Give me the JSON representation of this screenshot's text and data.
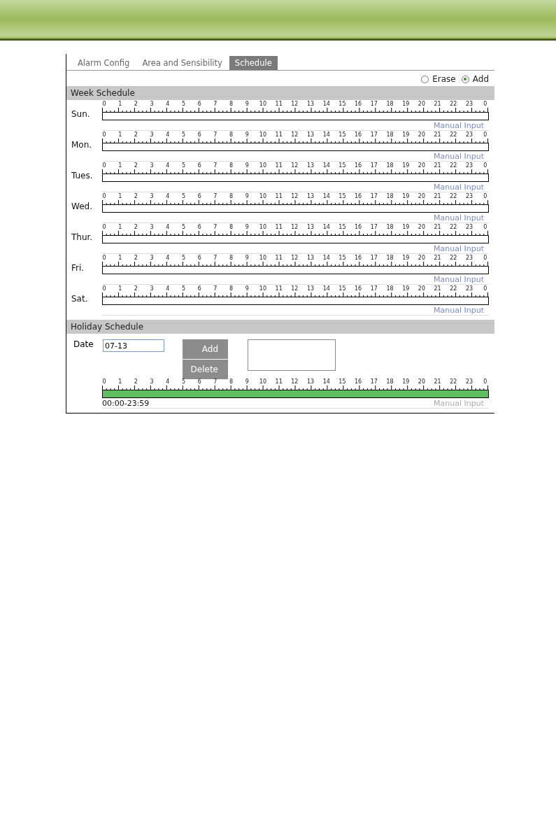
{
  "tabs": [
    {
      "label": "Alarm Config",
      "selected": false
    },
    {
      "label": "Area and Sensibility",
      "selected": false
    },
    {
      "label": "Schedule",
      "selected": true
    }
  ],
  "mode_options": [
    {
      "label": "Erase",
      "selected": false
    },
    {
      "label": "Add",
      "selected": true
    }
  ],
  "week_schedule": {
    "title": "Week Schedule",
    "days": [
      {
        "label": "Sun.",
        "hours": [
          "0",
          "1",
          "2",
          "3",
          "4",
          "5",
          "6",
          "7",
          "8",
          "9",
          "10",
          "11",
          "12",
          "13",
          "14",
          "15",
          "16",
          "17",
          "18",
          "19",
          "20",
          "21",
          "22",
          "23",
          "0"
        ],
        "manual_input": "Manual Input"
      },
      {
        "label": "Mon.",
        "hours": [
          "0",
          "1",
          "2",
          "3",
          "4",
          "5",
          "6",
          "7",
          "8",
          "9",
          "10",
          "11",
          "12",
          "13",
          "14",
          "15",
          "16",
          "17",
          "18",
          "19",
          "20",
          "21",
          "22",
          "23",
          "0"
        ],
        "manual_input": "Manual Input"
      },
      {
        "label": "Tues.",
        "hours": [
          "0",
          "1",
          "2",
          "3",
          "4",
          "5",
          "6",
          "7",
          "8",
          "9",
          "10",
          "11",
          "12",
          "13",
          "14",
          "15",
          "16",
          "17",
          "18",
          "19",
          "20",
          "21",
          "22",
          "23",
          "0"
        ],
        "manual_input": "Manual Input"
      },
      {
        "label": "Wed.",
        "hours": [
          "0",
          "1",
          "2",
          "3",
          "4",
          "5",
          "6",
          "7",
          "8",
          "9",
          "10",
          "11",
          "12",
          "13",
          "14",
          "15",
          "16",
          "17",
          "18",
          "19",
          "20",
          "21",
          "22",
          "23",
          "0"
        ],
        "manual_input": "Manual Input"
      },
      {
        "label": "Thur.",
        "hours": [
          "0",
          "1",
          "2",
          "3",
          "4",
          "5",
          "6",
          "7",
          "8",
          "9",
          "10",
          "11",
          "12",
          "13",
          "14",
          "15",
          "16",
          "17",
          "18",
          "19",
          "20",
          "21",
          "22",
          "23",
          "0"
        ],
        "manual_input": "Manual Input"
      },
      {
        "label": "Fri.",
        "hours": [
          "0",
          "1",
          "2",
          "3",
          "4",
          "5",
          "6",
          "7",
          "8",
          "9",
          "10",
          "11",
          "12",
          "13",
          "14",
          "15",
          "16",
          "17",
          "18",
          "19",
          "20",
          "21",
          "22",
          "23",
          "0"
        ],
        "manual_input": "Manual Input"
      },
      {
        "label": "Sat.",
        "hours": [
          "0",
          "1",
          "2",
          "3",
          "4",
          "5",
          "6",
          "7",
          "8",
          "9",
          "10",
          "11",
          "12",
          "13",
          "14",
          "15",
          "16",
          "17",
          "18",
          "19",
          "20",
          "21",
          "22",
          "23",
          "0"
        ],
        "manual_input": "Manual Input"
      }
    ]
  },
  "holiday_schedule": {
    "title": "Holiday Schedule",
    "date_label": "Date",
    "date_value": "07-13",
    "buttons": [
      "Add",
      "Delete"
    ],
    "hours": [
      "0",
      "1",
      "2",
      "3",
      "4",
      "5",
      "6",
      "7",
      "8",
      "9",
      "10",
      "11",
      "12",
      "13",
      "14",
      "15",
      "16",
      "17",
      "18",
      "19",
      "20",
      "21",
      "22",
      "23",
      "0"
    ],
    "level": 1,
    "time_range": "00:00-23:59",
    "manual_input": "Manual Input",
    "manual_input_disabled": true
  }
}
